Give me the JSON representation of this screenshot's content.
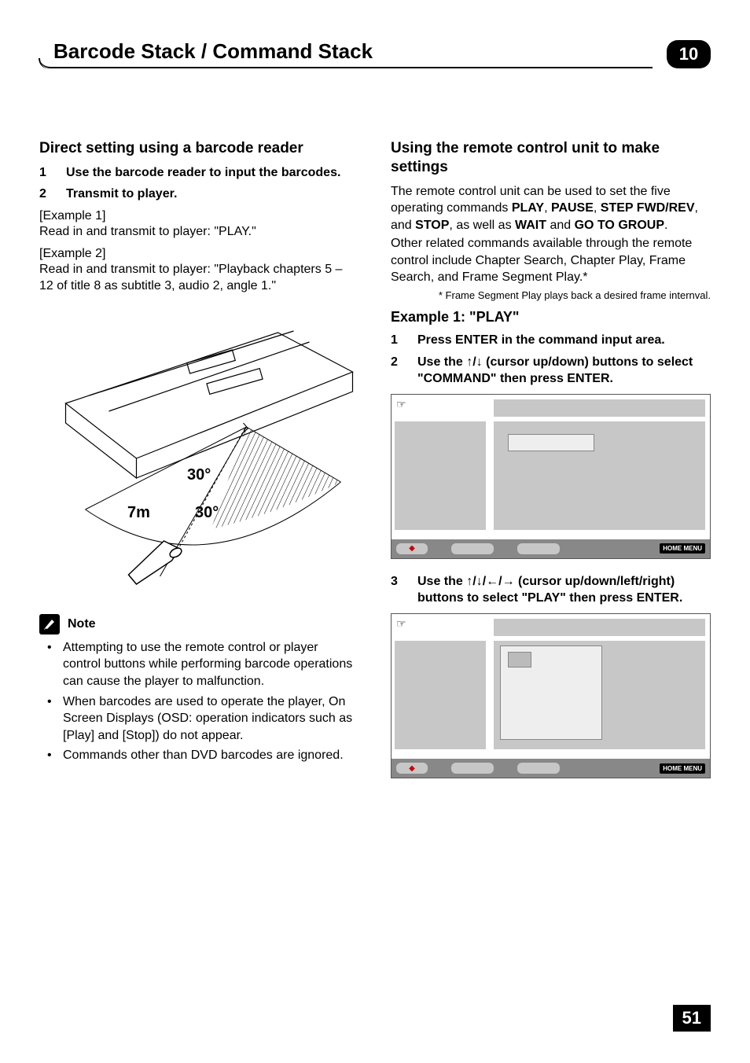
{
  "header": {
    "title": "Barcode Stack / Command Stack",
    "chapter": "10"
  },
  "left": {
    "h1": "Direct setting using a barcode reader",
    "step1_num": "1",
    "step1": "Use the barcode reader to input the barcodes.",
    "step2_num": "2",
    "step2": "Transmit to player.",
    "ex1_label": "[Example 1]",
    "ex1_body": "Read in and transmit to player: \"PLAY.\"",
    "ex2_label": "[Example 2]",
    "ex2_body": "Read in and transmit to player: \"Playback chapters 5 – 12 of title 8 as subtitle 3, audio 2, angle 1.\"",
    "fig": {
      "dist": "7m",
      "angle1": "30°",
      "angle2": "30°"
    },
    "note_title": "Note",
    "notes": [
      "Attempting to use the remote control or player control buttons while performing barcode operations can cause the player to malfunction.",
      "When barcodes are used to operate the player, On Screen Displays (OSD: operation indicators such as [Play] and [Stop]) do not appear.",
      "Commands other than DVD barcodes are ignored."
    ]
  },
  "right": {
    "h1": "Using the remote control unit to make settings",
    "p1a": "The remote control unit can be used to set the five operating commands ",
    "p1_play": "PLAY",
    "p1_pause": "PAUSE",
    "p1_step": "STEP FWD/REV",
    "p1_stop": "STOP",
    "p1_wait": "WAIT",
    "p1_go": "GO TO GROUP",
    "p1_mid1": ", ",
    "p1_mid2": ", ",
    "p1_mid3": ", and ",
    "p1_mid4": ", as well as ",
    "p1_mid5": " and ",
    "p1_end": ".",
    "p2": "Other related commands available through the remote control include Chapter Search, Chapter Play, Frame Search, and Frame Segment Play.*",
    "footnote": "* Frame Segment Play plays back a desired frame internval.",
    "ex_h": "Example 1:  \"PLAY\"",
    "s1_num": "1",
    "s1": "Press ENTER in the command input area.",
    "s2_num": "2",
    "s2a": "Use the ",
    "s2b": " (cursor up/down) buttons to select \"COMMAND\" then press ENTER.",
    "s3_num": "3",
    "s3a": "Use the ",
    "s3b": " (cursor up/down/left/right) buttons to select \"PLAY\" then press ENTER.",
    "home_menu": "HOME MENU"
  },
  "page_number": "51"
}
